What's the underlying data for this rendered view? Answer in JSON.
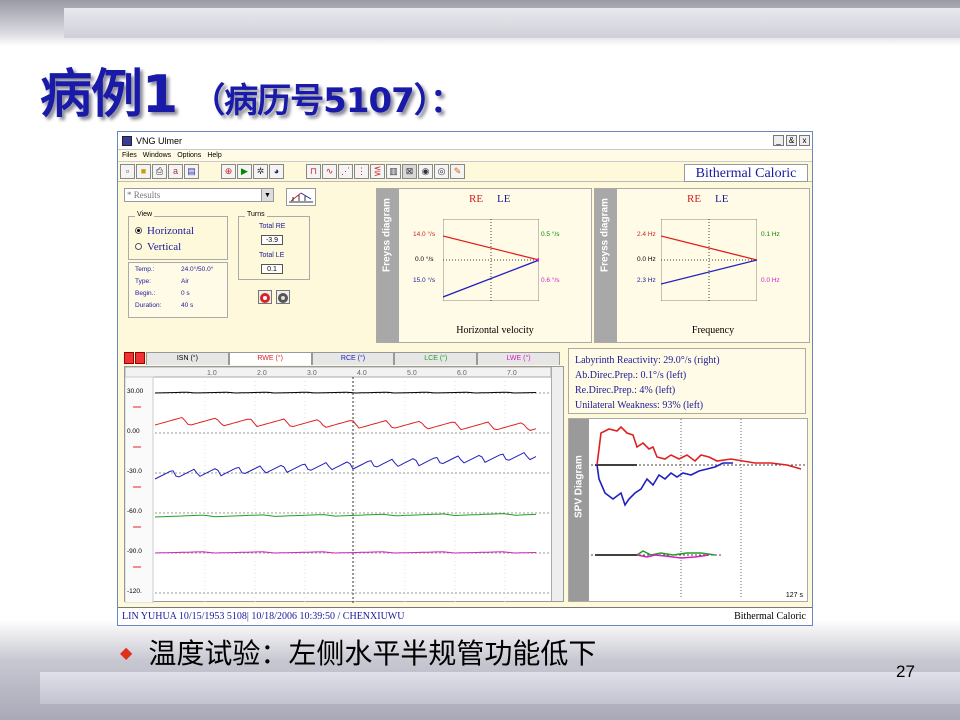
{
  "slide": {
    "title_main": "病例1",
    "title_sub": "（病历号5107）：",
    "bullet": "温度试验：左侧水平半规管功能低下",
    "page_number": "27"
  },
  "app": {
    "window_title": "VNG Ulmer",
    "window_buttons": [
      "_",
      "&",
      "x"
    ],
    "menu": [
      "Files",
      "Windows",
      "Options",
      "Help"
    ],
    "mode_title": "Bithermal Caloric",
    "results_select": "* Results",
    "view": {
      "legend": "View",
      "options": [
        {
          "label": "Horizontal",
          "selected": true
        },
        {
          "label": "Vertical",
          "selected": false
        }
      ]
    },
    "turns": {
      "legend": "Turns",
      "total_re_label": "Total RE",
      "total_re_value": "-3.9",
      "total_le_label": "Total LE",
      "total_le_value": "0.1"
    },
    "info": [
      {
        "key": "Temp.:",
        "value": "24.0°/50.0°"
      },
      {
        "key": "Type:",
        "value": "Air"
      },
      {
        "key": "Begin.:",
        "value": "0 s"
      },
      {
        "key": "Duration:",
        "value": "40 s"
      }
    ],
    "freyss_velocity": {
      "side_label": "Freyss diagram",
      "re": "RE",
      "le": "LE",
      "left_top": "14.0 °/s",
      "left_mid": "0.0 °/s",
      "left_bot": "15.0 °/s",
      "right_top": "0.5 °/s",
      "right_bot": "0.6 °/s",
      "footer": "Horizontal velocity"
    },
    "freyss_frequency": {
      "side_label": "Freyss diagram",
      "re": "RE",
      "le": "LE",
      "left_top": "2.4 Hz",
      "left_mid": "0.0 Hz",
      "left_bot": "2.3 Hz",
      "right_top": "0.1 Hz",
      "right_bot": "0.0 Hz",
      "footer": "Frequency"
    },
    "tabs": [
      "ISN (°)",
      "RWE (°)",
      "RCE (°)",
      "LCE (°)",
      "LWE (°)"
    ],
    "tab_colors": [
      "#000000",
      "#e02020",
      "#2020c0",
      "#20a020",
      "#d020c0"
    ],
    "time_ticks": [
      "1.0",
      "2.0",
      "3.0",
      "4.0",
      "5.0",
      "6.0",
      "7.0"
    ],
    "y_ticks": [
      "30.00",
      "0.00",
      "-30.0",
      "-60.0",
      "-90.0",
      "-120."
    ],
    "reactivity": [
      "Labyrinth Reactivity: 29.0°/s (right)",
      "Ab.Direc.Prep.: 0.1°/s (left)",
      "Re.Direc.Prep.: 4% (left)",
      "Unilateral Weakness: 93% (left)"
    ],
    "spv": {
      "side_label": "SPV Diagram",
      "seconds": "127 s"
    },
    "status_left": "LIN YUHUA  10/15/1953  5108| 10/18/2006 10:39:50  / CHENXIUWU",
    "status_right": "Bithermal Caloric"
  }
}
